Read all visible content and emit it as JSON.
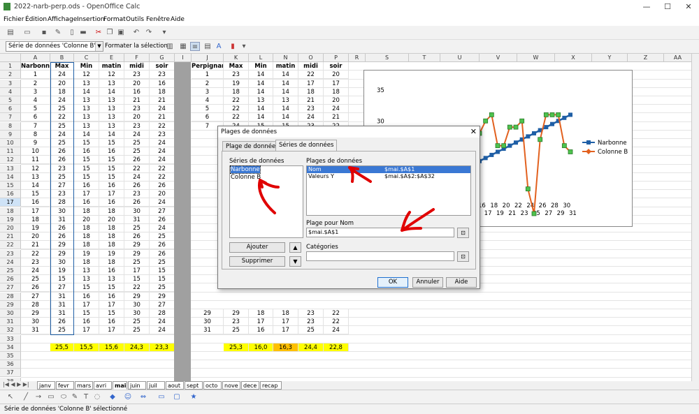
{
  "window": {
    "title": "2022-narb-perp.ods - OpenOffice Calc",
    "minimize": "—",
    "maximize": "☐",
    "close": "✕"
  },
  "menu": [
    "Fichier",
    "Édition",
    "Affichage",
    "Insertion",
    "Format",
    "Outils",
    "Fenêtre",
    "Aide"
  ],
  "toolbar2": {
    "selection": "Série de données 'Colonne B'",
    "format_label": "Formater la sélection"
  },
  "columns": [
    "A",
    "B",
    "C",
    "E",
    "F",
    "G",
    "I",
    "J",
    "K",
    "L",
    "N",
    "O",
    "P",
    "R",
    "S",
    "T",
    "U",
    "V",
    "W",
    "X",
    "Y",
    "Z",
    "AA"
  ],
  "header_left": [
    "Narbonne",
    "Max",
    "Min",
    "matin",
    "midi",
    "soir"
  ],
  "header_right": [
    "Perpignan",
    "Max",
    "Min",
    "matin",
    "midi",
    "soir"
  ],
  "left_rows": [
    [
      1,
      24,
      12,
      12,
      23,
      23
    ],
    [
      2,
      20,
      13,
      13,
      20,
      16
    ],
    [
      3,
      18,
      14,
      14,
      16,
      18
    ],
    [
      4,
      24,
      13,
      13,
      21,
      21
    ],
    [
      5,
      25,
      13,
      13,
      23,
      24
    ],
    [
      6,
      22,
      13,
      13,
      20,
      21
    ],
    [
      7,
      25,
      13,
      13,
      23,
      22
    ],
    [
      8,
      24,
      14,
      14,
      24,
      23
    ],
    [
      9,
      25,
      15,
      15,
      25,
      24
    ],
    [
      10,
      26,
      16,
      16,
      25,
      24
    ],
    [
      11,
      26,
      15,
      15,
      26,
      24
    ],
    [
      12,
      23,
      15,
      15,
      22,
      22
    ],
    [
      13,
      25,
      15,
      15,
      24,
      22
    ],
    [
      14,
      27,
      16,
      16,
      26,
      26
    ],
    [
      15,
      23,
      17,
      17,
      23,
      20
    ],
    [
      16,
      28,
      16,
      16,
      26,
      24
    ],
    [
      17,
      30,
      18,
      18,
      30,
      27
    ],
    [
      18,
      31,
      20,
      20,
      31,
      26
    ],
    [
      19,
      26,
      18,
      18,
      25,
      24
    ],
    [
      20,
      26,
      18,
      18,
      26,
      25
    ],
    [
      21,
      29,
      18,
      18,
      29,
      26
    ],
    [
      22,
      29,
      19,
      19,
      29,
      26
    ],
    [
      23,
      30,
      18,
      18,
      25,
      25
    ],
    [
      24,
      19,
      13,
      16,
      17,
      15
    ],
    [
      25,
      15,
      13,
      13,
      15,
      15
    ],
    [
      26,
      27,
      15,
      15,
      22,
      25
    ],
    [
      27,
      31,
      16,
      16,
      29,
      29
    ],
    [
      28,
      31,
      17,
      17,
      30,
      27
    ],
    [
      29,
      31,
      15,
      15,
      30,
      28
    ],
    [
      30,
      26,
      16,
      16,
      25,
      24
    ],
    [
      31,
      25,
      17,
      17,
      25,
      24
    ]
  ],
  "right_rows": [
    [
      1,
      23,
      14,
      14,
      22,
      20
    ],
    [
      2,
      19,
      14,
      14,
      17,
      17
    ],
    [
      3,
      18,
      14,
      14,
      18,
      18
    ],
    [
      4,
      22,
      13,
      13,
      21,
      20
    ],
    [
      5,
      22,
      14,
      14,
      23,
      24
    ],
    [
      6,
      22,
      14,
      14,
      24,
      21
    ],
    [
      7,
      24,
      15,
      15,
      23,
      22
    ],
    [
      29,
      29,
      18,
      18,
      23,
      22
    ],
    [
      30,
      23,
      17,
      17,
      23,
      22
    ],
    [
      31,
      25,
      16,
      17,
      25,
      24
    ]
  ],
  "right_row_nums": [
    1,
    2,
    3,
    4,
    5,
    6,
    7,
    29,
    30,
    31
  ],
  "averages_left": [
    "25,5",
    "15,5",
    "15,6",
    "24,3",
    "23,3"
  ],
  "averages_right": [
    "25,3",
    "16,0",
    "16,3",
    "24,4",
    "22,8"
  ],
  "chart_data": {
    "type": "line",
    "y_ticks": [
      "35",
      "30",
      "25"
    ],
    "x_ticks": [
      "16",
      "18",
      "20",
      "22",
      "24",
      "26",
      "28",
      "30",
      "17",
      "19",
      "21",
      "23",
      "25",
      "27",
      "29",
      "31"
    ],
    "legend": [
      "Narbonne",
      "Colonne B"
    ],
    "series": [
      {
        "name": "Narbonne",
        "color": "#1f5fa6",
        "values": [
          16,
          16.5,
          17,
          17.5,
          18,
          18.5,
          19,
          19.5,
          20,
          20.5,
          21,
          21.5,
          22,
          22.5,
          23,
          23.5,
          24,
          24.5,
          25,
          25.5,
          26,
          26.5,
          27,
          27.5,
          28,
          28.5,
          29,
          29.5,
          30,
          30.5,
          31
        ]
      },
      {
        "name": "Colonne B",
        "color": "#e2611f",
        "values": [
          24,
          20,
          18,
          24,
          25,
          22,
          25,
          24,
          25,
          26,
          26,
          23,
          25,
          27,
          23,
          28,
          30,
          31,
          26,
          26,
          29,
          29,
          30,
          19,
          15,
          27,
          31,
          31,
          31,
          26,
          25
        ]
      }
    ]
  },
  "dialog": {
    "title": "Plages de données",
    "tabs": [
      "Plage de données",
      "Séries de données"
    ],
    "series_label": "Séries de données",
    "series": [
      "Narbonne",
      "Colonne B"
    ],
    "ranges_label": "Plages de données",
    "ranges": [
      [
        "Nom",
        "$mai.$A$1"
      ],
      [
        "Valeurs Y",
        "$mai.$A$2:$A$32"
      ]
    ],
    "name_range_label": "Plage pour Nom",
    "name_range_value": "$mai.$A$1",
    "categories_label": "Catégories",
    "add": "Ajouter",
    "remove": "Supprimer",
    "ok": "OK",
    "cancel": "Annuler",
    "help": "Aide"
  },
  "sheets": [
    "janv",
    "fevr",
    "mars",
    "avri",
    "mai",
    "juin",
    "juil",
    "aout",
    "sept",
    "octo",
    "nove",
    "dece",
    "recap"
  ],
  "status": "Série de données 'Colonne B' sélectionné"
}
